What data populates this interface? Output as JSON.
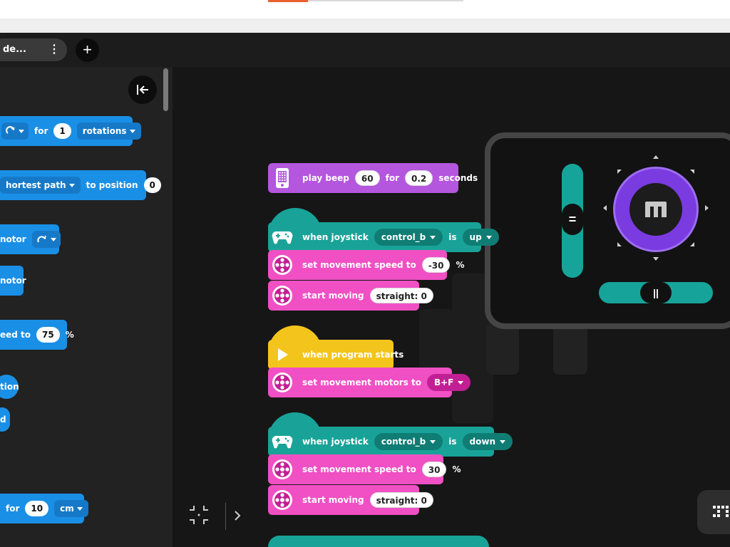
{
  "tabbar": {
    "project_tab_label": "de...",
    "menu_glyph": "⋮",
    "add_glyph": "+"
  },
  "palette": {
    "blocks": {
      "rotations": {
        "value": "1",
        "unit": "rotations",
        "for_label": "for"
      },
      "shortest": {
        "label": "hortest path",
        "to_label": "to position",
        "value": "0"
      },
      "motor_dir": {
        "label": "notor"
      },
      "motor": {
        "label": "notor"
      },
      "speed": {
        "label": "eed to",
        "value": "75",
        "unit": "%"
      },
      "tion": {
        "label": "tion"
      },
      "d": {
        "label": "d"
      },
      "cm": {
        "for_label": "for",
        "value": "10",
        "unit": "cm"
      }
    }
  },
  "canvas": {
    "beep": {
      "label": "play beep",
      "note": "60",
      "for_label": "for",
      "duration": "0.2",
      "unit": "seconds"
    },
    "joystick_up": {
      "label": "when joystick",
      "joystick": "control_b",
      "is_label": "is",
      "direction": "up",
      "speed_label": "set movement speed to",
      "speed": "-30",
      "speed_unit": "%",
      "move_label": "start moving",
      "move_value": "straight: 0"
    },
    "program_start": {
      "label": "when program starts",
      "motors_label": "set movement motors to",
      "motors": "B+F"
    },
    "joystick_down": {
      "label": "when joystick",
      "joystick": "control_b",
      "is_label": "is",
      "direction": "down",
      "speed_label": "set movement speed to",
      "speed": "30",
      "speed_unit": "%",
      "move_label": "start moving",
      "move_value": "straight: 0"
    }
  },
  "widget": {
    "vslider_glyph": "=",
    "hslider_glyph": "||"
  },
  "colors": {
    "accent": "#e8612c",
    "palette_blue": "#1a8fe6",
    "sound_purple": "#b456de",
    "event_teal": "#19a398",
    "motion_pink": "#f050c4",
    "start_yellow": "#f3c51c",
    "joystick_ring": "#7a3be0"
  }
}
